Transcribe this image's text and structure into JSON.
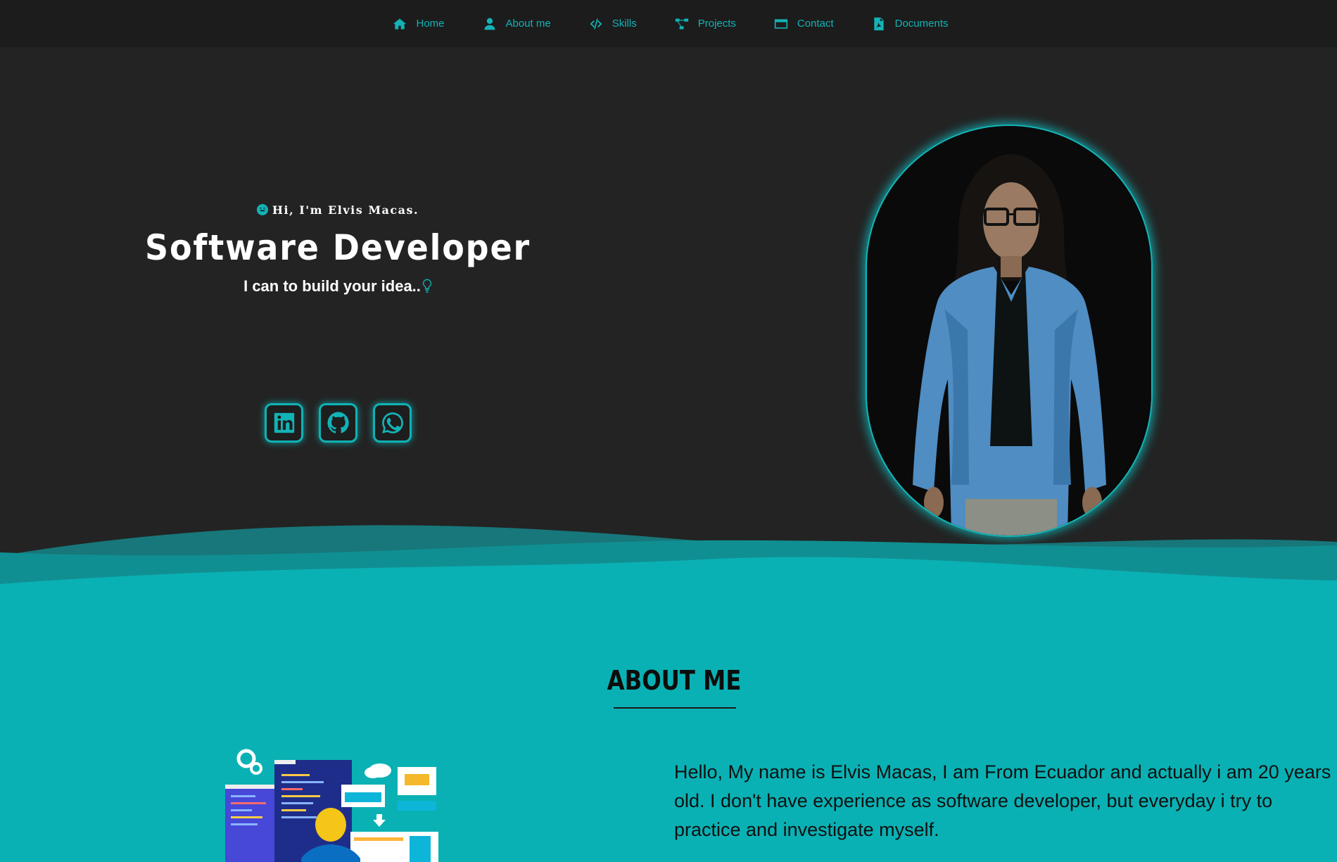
{
  "nav": {
    "items": [
      {
        "label": "Home",
        "icon": "home-icon"
      },
      {
        "label": "About me",
        "icon": "user-icon"
      },
      {
        "label": "Skills",
        "icon": "code-icon"
      },
      {
        "label": "Projects",
        "icon": "project-diagram-icon"
      },
      {
        "label": "Contact",
        "icon": "id-card-icon"
      },
      {
        "label": "Documents",
        "icon": "pdf-file-icon"
      }
    ]
  },
  "hero": {
    "greeting": "Hi, I'm Elvis Macas.",
    "title": "Software Developer",
    "tagline": "I can to build your idea..",
    "socials": [
      {
        "name": "LinkedIn",
        "icon": "linkedin-icon"
      },
      {
        "name": "GitHub",
        "icon": "github-icon"
      },
      {
        "name": "WhatsApp",
        "icon": "whatsapp-icon"
      }
    ]
  },
  "about": {
    "title": "ABOUT ME",
    "text": "Hello, My name is Elvis Macas, I am From Ecuador and actually i am 20 years old. I don't have experience as software developer, but everyday i try to practice and investigate myself."
  },
  "colors": {
    "accent": "#12b3b6",
    "background": "#232323",
    "nav_background": "#1c1c1c",
    "about_background": "#0ab1b4"
  }
}
